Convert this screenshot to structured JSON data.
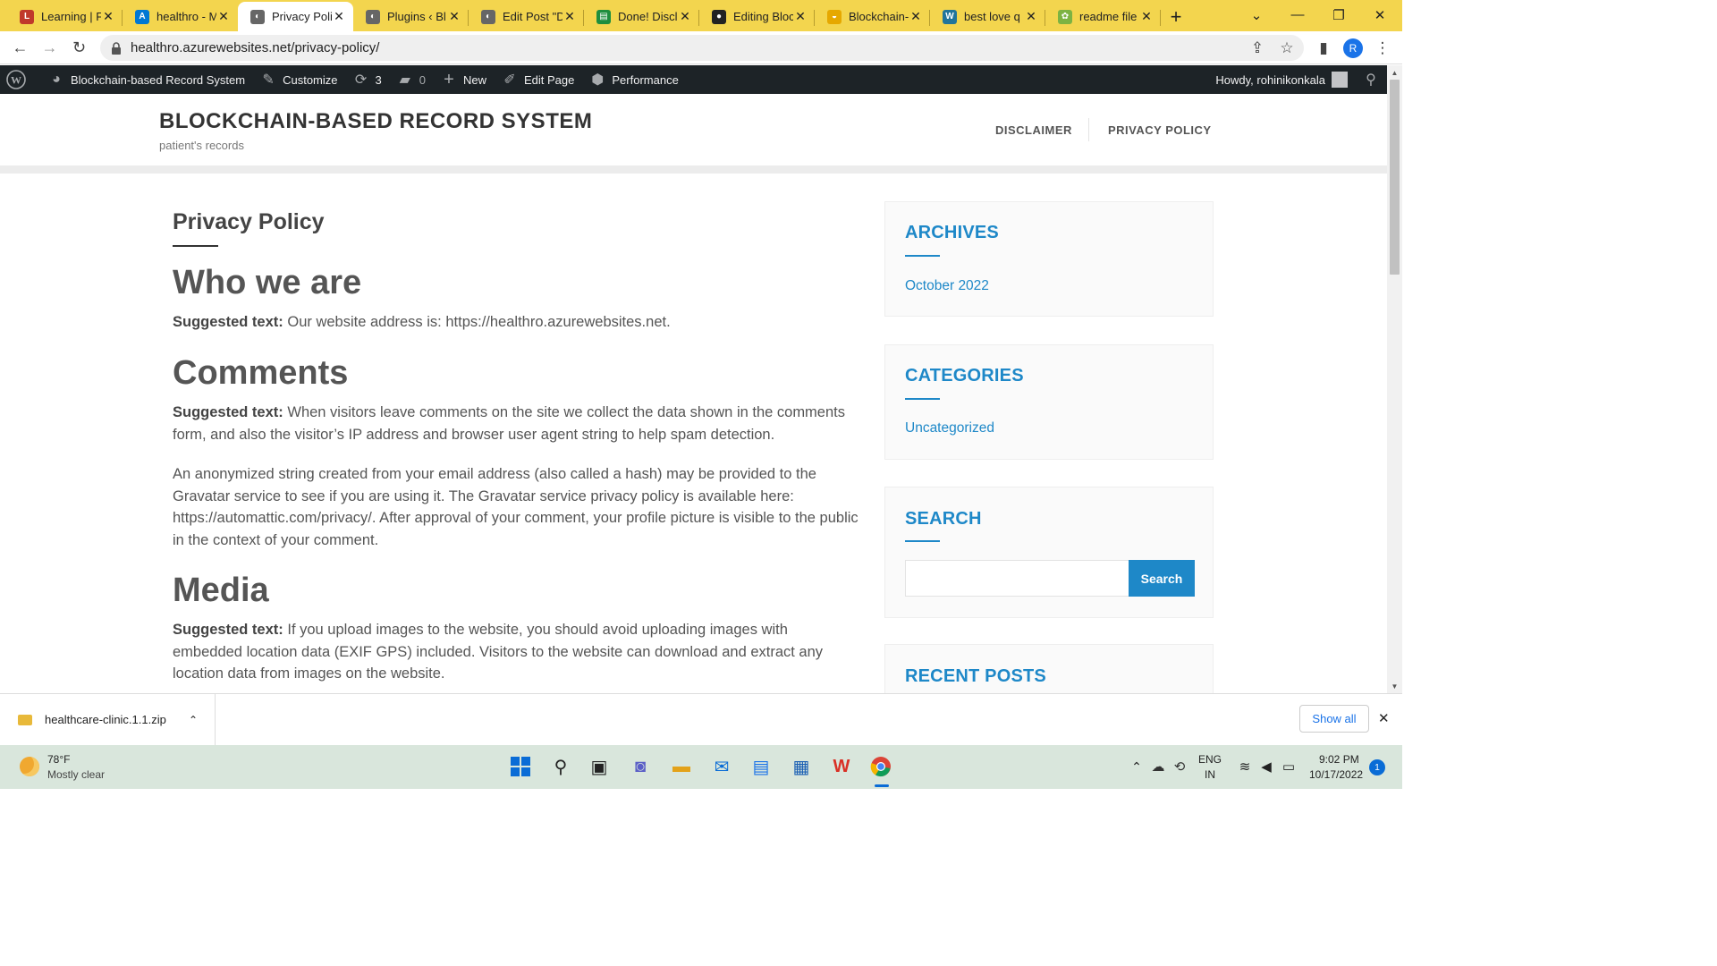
{
  "browser": {
    "tabs": [
      {
        "label": "Learning | F",
        "color": "#c0392b",
        "glyph": "L"
      },
      {
        "label": "healthro - M",
        "color": "#0078d4",
        "glyph": "A"
      },
      {
        "label": "Privacy Poli",
        "color": "#666666",
        "glyph": "◐",
        "active": true
      },
      {
        "label": "Plugins ‹ Bl",
        "color": "#666666",
        "glyph": "◐"
      },
      {
        "label": "Edit Post \"D",
        "color": "#666666",
        "glyph": "◐"
      },
      {
        "label": "Done! Discl",
        "color": "#1e8e3e",
        "glyph": "▤"
      },
      {
        "label": "Editing Bloc",
        "color": "#222222",
        "glyph": "●"
      },
      {
        "label": "Blockchain-",
        "color": "#e6a800",
        "glyph": "◒"
      },
      {
        "label": "best love q",
        "color": "#21759b",
        "glyph": "W"
      },
      {
        "label": "readme file",
        "color": "#7cb342",
        "glyph": "✿"
      }
    ],
    "url": "healthro.azurewebsites.net/privacy-policy/",
    "profile_initial": "R"
  },
  "adminbar": {
    "site_name": "Blockchain-based Record System",
    "customize": "Customize",
    "updates_count": "3",
    "comments_count": "0",
    "new": "New",
    "edit_page": "Edit Page",
    "performance": "Performance",
    "howdy": "Howdy, rohinikonkala"
  },
  "site": {
    "title": "BLOCKCHAIN-BASED RECORD SYSTEM",
    "tagline": "patient's records",
    "nav": [
      "DISCLAIMER",
      "PRIVACY POLICY"
    ]
  },
  "page": {
    "title": "Privacy Policy",
    "sections": [
      {
        "heading": "Who we are",
        "label": "Suggested text:",
        "text": " Our website address is: https://healthro.azurewebsites.net."
      },
      {
        "heading": "Comments",
        "label": "Suggested text:",
        "text": " When visitors leave comments on the site we collect the data shown in the comments form, and also the visitor’s IP address and browser user agent string to help spam detection."
      },
      {
        "heading": "",
        "label": "",
        "text": "An anonymized string created from your email address (also called a hash) may be provided to the Gravatar service to see if you are using it. The Gravatar service privacy policy is available here: https://automattic.com/privacy/. After approval of your comment, your profile picture is visible to the public in the context of your comment."
      },
      {
        "heading": "Media",
        "label": "Suggested text:",
        "text": " If you upload images to the website, you should avoid uploading images with embedded location data (EXIF GPS) included. Visitors to the website can download and extract any location data from images on the website."
      }
    ]
  },
  "sidebar": {
    "archives_title": "ARCHIVES",
    "archives_item": "October 2022",
    "categories_title": "CATEGORIES",
    "categories_item": "Uncategorized",
    "search_title": "SEARCH",
    "search_button": "Search",
    "recent_title": "RECENT POSTS"
  },
  "downloads": {
    "file": "healthcare-clinic.1.1.zip",
    "show_all": "Show all"
  },
  "taskbar": {
    "temp": "78°F",
    "weather": "Mostly clear",
    "lang1": "ENG",
    "lang2": "IN",
    "time": "9:02 PM",
    "date": "10/17/2022",
    "notif": "1"
  }
}
